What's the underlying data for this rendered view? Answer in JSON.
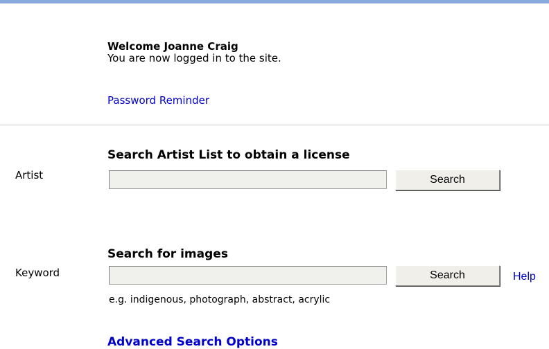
{
  "welcome": {
    "heading": "Welcome Joanne Craig",
    "message": "You are now logged in to the site.",
    "password_link": "Password Reminder"
  },
  "artist_search": {
    "heading": "Search Artist List to obtain a license",
    "label": "Artist",
    "value": "",
    "button_label": "Search"
  },
  "image_search": {
    "heading": "Search for images",
    "label": "Keyword",
    "value": "",
    "button_label": "Search",
    "help_link": "Help",
    "example": "e.g. indigenous, photograph, abstract, acrylic"
  },
  "advanced_link": "Advanced Search Options",
  "colors": {
    "top_bar": "#88aadd",
    "link": "#0000cc",
    "divider": "#c8c8c8",
    "input_bg": "#f0f0ec",
    "button_bg": "#f0efe9"
  }
}
